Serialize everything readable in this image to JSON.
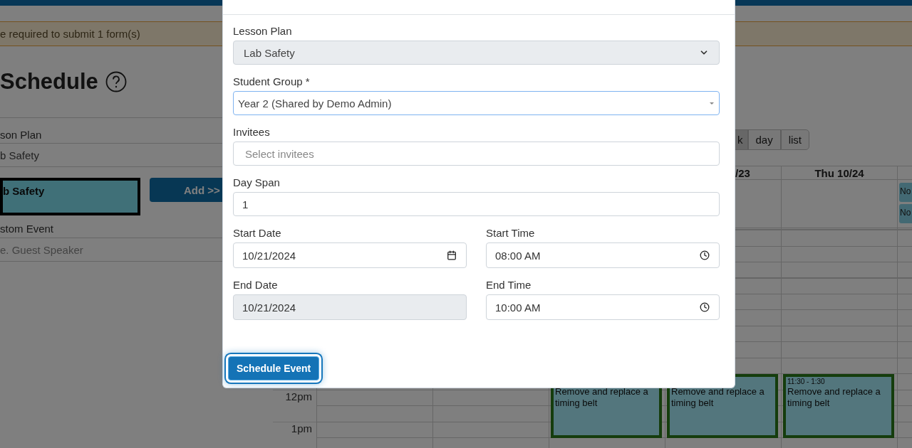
{
  "alert": {
    "text": "e required to submit 1 form(s)"
  },
  "page_title": "Schedule",
  "sidebar": {
    "lesson_plan_label": "son Plan",
    "lesson_plan_value": "b Safety",
    "lesson_card": "b Safety",
    "add_button": "Add >>",
    "custom_event_label": "stom Event",
    "custom_event_placeholder": "e. Guest Speaker"
  },
  "calendar": {
    "views": [
      {
        "label": "k",
        "selected": true
      },
      {
        "label": "day",
        "selected": false
      },
      {
        "label": "list",
        "selected": false
      }
    ],
    "time_labels": [
      "12pm",
      "1pm"
    ],
    "days": [
      {
        "events": [
          {
            "title": "Remove and replace a timing belt"
          }
        ]
      },
      {
        "header": "/23",
        "events": [
          {
            "title": "Remove and replace a timing belt"
          }
        ]
      },
      {
        "header": "Thu 10/24",
        "events": [
          {
            "time": "11:30 - 1:30",
            "title": "Remove and replace a timing belt"
          }
        ]
      },
      {
        "all_day": [
          "No",
          "No"
        ]
      }
    ]
  },
  "modal": {
    "fields": [
      {
        "kind": "select",
        "label": "Lesson Plan",
        "value": "Lab Safety",
        "disabled": true
      },
      {
        "kind": "combo",
        "label": "Student Group *",
        "value": "Year 2 (Shared by Demo Admin)",
        "focused": true
      },
      {
        "kind": "text",
        "label": "Invitees",
        "placeholder": "Select invitees"
      },
      {
        "kind": "text",
        "label": "Day Span",
        "value": "1"
      },
      {
        "kind": "pair",
        "items": [
          {
            "kind": "date",
            "label": "Start Date",
            "value": "10/21/2024"
          },
          {
            "kind": "time",
            "label": "Start Time",
            "value": "08:00 AM"
          }
        ]
      },
      {
        "kind": "pair",
        "items": [
          {
            "kind": "date",
            "label": "End Date",
            "value": "10/21/2024",
            "disabled": true
          },
          {
            "kind": "time",
            "label": "End Time",
            "value": "10:00 AM"
          }
        ]
      }
    ],
    "submit": {
      "label": "Schedule Event",
      "focused": true
    }
  }
}
